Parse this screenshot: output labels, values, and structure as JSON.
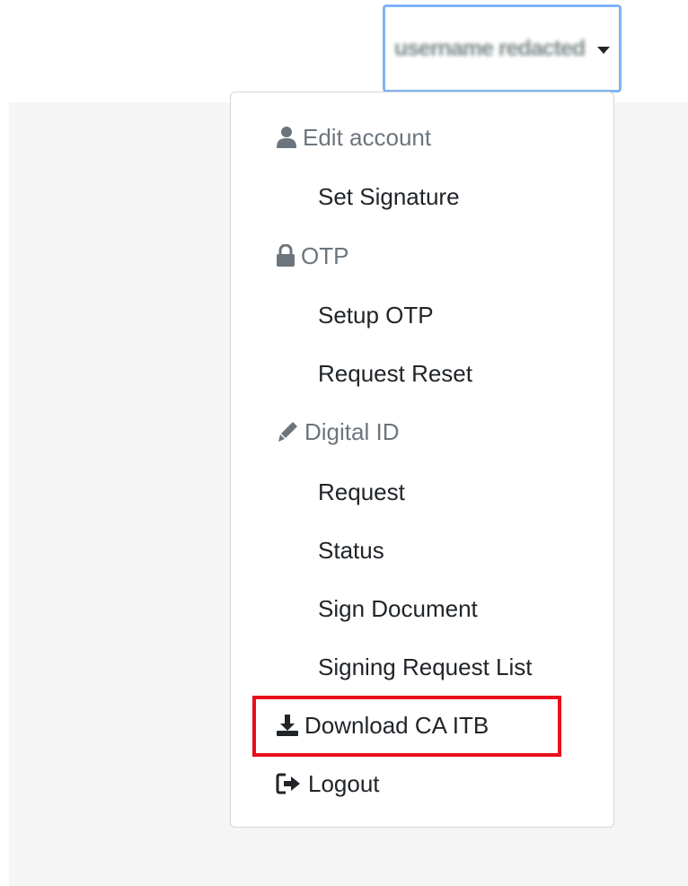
{
  "user_menu": {
    "username": "username redacted",
    "toggle_accent": "#80b4f5"
  },
  "dropdown": {
    "sections": [
      {
        "header": "Edit account",
        "icon": "user-icon",
        "items": [
          "Set Signature"
        ]
      },
      {
        "header": "OTP",
        "icon": "lock-icon",
        "items": [
          "Setup OTP",
          "Request Reset"
        ]
      },
      {
        "header": "Digital ID",
        "icon": "pen-icon",
        "items": [
          "Request",
          "Status",
          "Sign Document",
          "Signing Request List"
        ]
      }
    ],
    "download": {
      "label": "Download CA ITB",
      "icon": "download-icon",
      "highlighted": true,
      "highlight_color": "#e8101a"
    },
    "logout": {
      "label": "Logout",
      "icon": "sign-out-icon"
    }
  }
}
